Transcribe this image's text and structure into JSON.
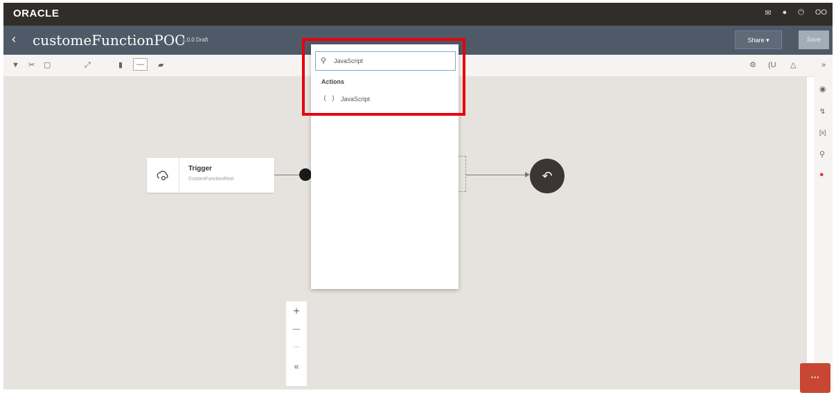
{
  "topbar": {
    "logo": "ORACLE",
    "icons": [
      "megaphone-icon",
      "help-icon",
      "power-icon"
    ],
    "user_initials": "OO"
  },
  "titlebar": {
    "back": "‹",
    "title": "customeFunctionPOC",
    "version": "1.0.0 Draft",
    "share_label": "Share ▾",
    "save_label": "Save"
  },
  "toolbar": {
    "left_icons": [
      "save-icon",
      "cut-icon",
      "copy-icon",
      "expand-icon",
      "layout-vertical-icon",
      "layout-horizontal-icon",
      "layout-split-icon"
    ],
    "right_icons": [
      "settings-icon",
      "variables-icon",
      "warning-icon",
      "collapse-icon"
    ]
  },
  "rightrail": {
    "icons": [
      "target-icon",
      "pin-icon",
      "bracket-icon",
      "search-icon",
      "integration-icon"
    ]
  },
  "trigger": {
    "title": "Trigger",
    "subtitle": "CustomFunctionRest"
  },
  "search": {
    "value": "JavaScript"
  },
  "results": {
    "section": "Actions",
    "items": [
      {
        "icon": "( )",
        "label": "JavaScript"
      }
    ]
  },
  "zoom": {
    "in": "+",
    "out": "—",
    "more": "···",
    "collapse": "«"
  },
  "chat": {
    "label": "···"
  },
  "colors": {
    "highlight": "#e8000b",
    "topbar": "#312d2a",
    "titlebar": "#4e5a68",
    "chat": "#c74634"
  }
}
